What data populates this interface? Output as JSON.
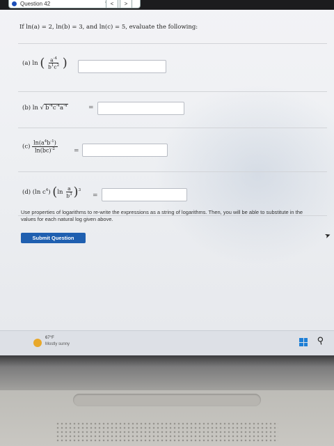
{
  "question_nav": {
    "label": "Question 42",
    "prev_glyph": "<",
    "next_glyph": ">"
  },
  "problem": {
    "prompt": "If ln(a) = 2, ln(b) = 3, and ln(c) = 5, evaluate the following:",
    "parts": [
      {
        "label": "(a)",
        "expr_ln": "ln",
        "numerator": "a",
        "num_sup": "-4",
        "denominator": "b",
        "den_sup1": "1",
        "den_mid": "c",
        "den_sup2": "2",
        "answer": ""
      },
      {
        "label": "(b)",
        "expr": "ln √",
        "b": "b",
        "b_sup": "-4",
        "c": "c",
        "c_sup": "-4",
        "a": "a",
        "a_sup": "-4",
        "answer": ""
      },
      {
        "label": "(c)",
        "num_ln": "ln(a",
        "num_sup1": "4",
        "num_b": "b",
        "num_sup2": "-1",
        "num_close": ")",
        "den": "ln(bc)",
        "den_sup": "-2",
        "answer": ""
      },
      {
        "label": "(d)",
        "left": "(ln c",
        "left_sup": "4",
        "left_close": ")",
        "right_ln": "ln",
        "right_num": "a",
        "right_den": "b",
        "right_den_sup": "3",
        "outer_sup": "3",
        "answer": ""
      }
    ],
    "equals": "="
  },
  "instructions": "Use properties of logarithms to re-write the expressions as a string of logarithms. Then, you will be able to substitute in the values for each natural log given above.",
  "submit_label": "Submit Question",
  "taskbar": {
    "weather_temp": "67°F",
    "weather_desc": "Mostly sunny"
  }
}
